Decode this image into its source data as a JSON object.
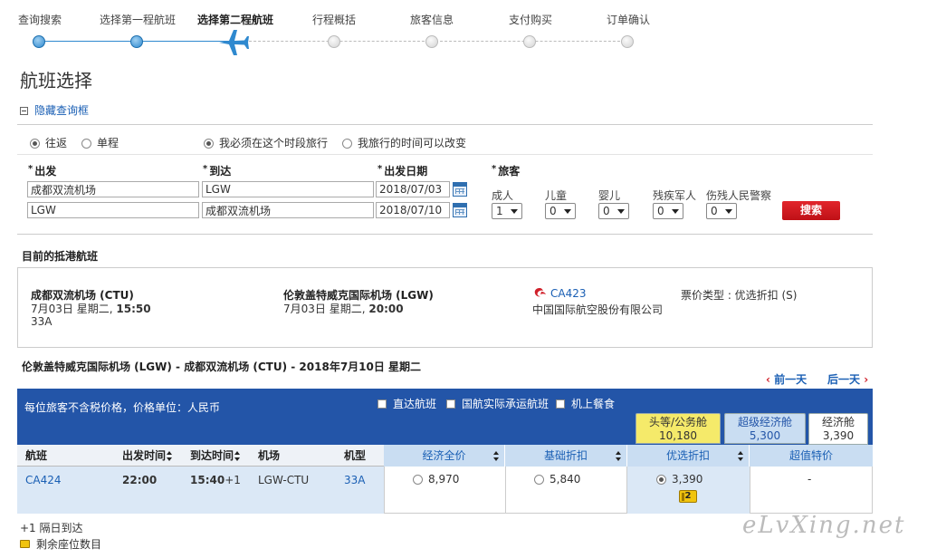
{
  "steps": [
    {
      "label": "查询搜索",
      "state": "done"
    },
    {
      "label": "选择第一程航班",
      "state": "done"
    },
    {
      "label": "选择第二程航班",
      "state": "current"
    },
    {
      "label": "行程概括",
      "state": "todo"
    },
    {
      "label": "旅客信息",
      "state": "todo"
    },
    {
      "label": "支付购买",
      "state": "todo"
    },
    {
      "label": "订单确认",
      "state": "todo"
    }
  ],
  "page_title": "航班选择",
  "toggle_search": "隐藏查询框",
  "trip_type": {
    "round": "往返",
    "oneway": "单程",
    "selected": "round"
  },
  "time_option": {
    "fixed": "我必须在这个时段旅行",
    "flexible": "我旅行的时间可以改变",
    "selected": "fixed"
  },
  "labels": {
    "from": "出发",
    "to": "到达",
    "date": "出发日期",
    "pax": "旅客",
    "req": "*"
  },
  "legs": [
    {
      "from": "成都双流机场",
      "to": "LGW",
      "date": "2018/07/03"
    },
    {
      "from": "LGW",
      "to": "成都双流机场",
      "date": "2018/07/10"
    }
  ],
  "pax": [
    {
      "label": "成人",
      "value": "1"
    },
    {
      "label": "儿童",
      "value": "0"
    },
    {
      "label": "婴儿",
      "value": "0"
    },
    {
      "label": "残疾军人",
      "value": "0"
    },
    {
      "label": "伤残人民警察",
      "value": "0"
    }
  ],
  "search_button": "搜索",
  "outbound": {
    "section_title": "目前的抵港航班",
    "from_airport": "成都双流机场 (CTU)",
    "from_date": "7月03日 星期二,",
    "from_time": "15:50",
    "aircraft": "33A",
    "to_airport": "伦敦盖特威克国际机场 (LGW)",
    "to_date": "7月03日 星期二,",
    "to_time": "20:00",
    "flight_no": "CA423",
    "airline": "中国国际航空股份有限公司",
    "fare_type": "票价类型 : 优选折扣 (S)"
  },
  "inbound_title": "伦敦盖特威克国际机场 (LGW) - 成都双流机场 (CTU) - 2018年7月10日 星期二",
  "prev_day": "前一天",
  "next_day": "后一天",
  "price_note": "每位旅客不含税价格，价格单位：人民币",
  "filters": [
    "直达航班",
    "国航实际承运航班",
    "机上餐食"
  ],
  "cabins": [
    {
      "name": "头等/公务舱",
      "price": "10,180",
      "color": "#f5ea6a"
    },
    {
      "name": "超级经济舱",
      "price": "5,300",
      "color": "#c9ddf2"
    },
    {
      "name": "经济舱",
      "price": "3,390",
      "color": "#ffffff"
    }
  ],
  "columns": {
    "flight": "航班",
    "depart": "出发时间",
    "arrive": "到达时间",
    "airport": "机场",
    "aircraft": "机型"
  },
  "fare_columns": [
    "经济全价",
    "基础折扣",
    "优选折扣",
    "超值特价"
  ],
  "flight_row": {
    "flight_no": "CA424",
    "depart": "22:00",
    "arrive": "15:40",
    "arrive_suffix": "+1",
    "airport": "LGW-CTU",
    "aircraft": "33A",
    "fares": [
      "8,970",
      "5,840",
      "3,390",
      "-"
    ],
    "selected_fare": 2,
    "seats_left": "2"
  },
  "legend_next_day": "+1 隔日到达",
  "legend_seats": "剩余座位数目",
  "watermark": "eLvXing.net",
  "colors": {
    "accent_blue": "#2355a8",
    "link_blue": "#1a5fb4",
    "search_red": "#d0202a",
    "fare_head_bg": "#c9ddf2",
    "selected_cell_bg": "#dbe8f6"
  }
}
